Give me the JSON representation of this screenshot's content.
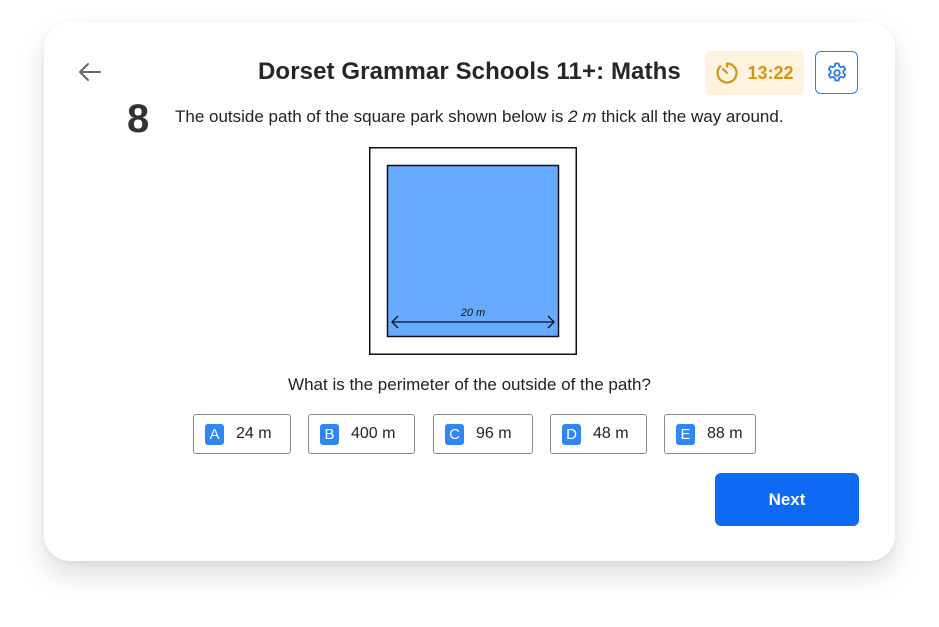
{
  "header": {
    "title": "Dorset Grammar Schools 11+: Maths",
    "timer": "13:22",
    "timer_color": "#d19612",
    "accent_color": "#2b7ce9"
  },
  "question": {
    "number": "8",
    "text_before": "The outside path of the square park shown below is ",
    "text_emph": "2 m",
    "text_after": " thick all the way around.",
    "figure": {
      "dimension_label": "20 m",
      "park_color": "#68aaff"
    },
    "prompt": "What is the perimeter of the outside of the path?"
  },
  "options": [
    {
      "letter": "A",
      "value": "24 m"
    },
    {
      "letter": "B",
      "value": "400 m"
    },
    {
      "letter": "C",
      "value": "96 m"
    },
    {
      "letter": "D",
      "value": "48 m"
    },
    {
      "letter": "E",
      "value": "88 m"
    }
  ],
  "actions": {
    "next_label": "Next"
  },
  "icons": {
    "back": "arrow-left-icon",
    "timer": "timer-icon",
    "settings": "gear-icon"
  }
}
